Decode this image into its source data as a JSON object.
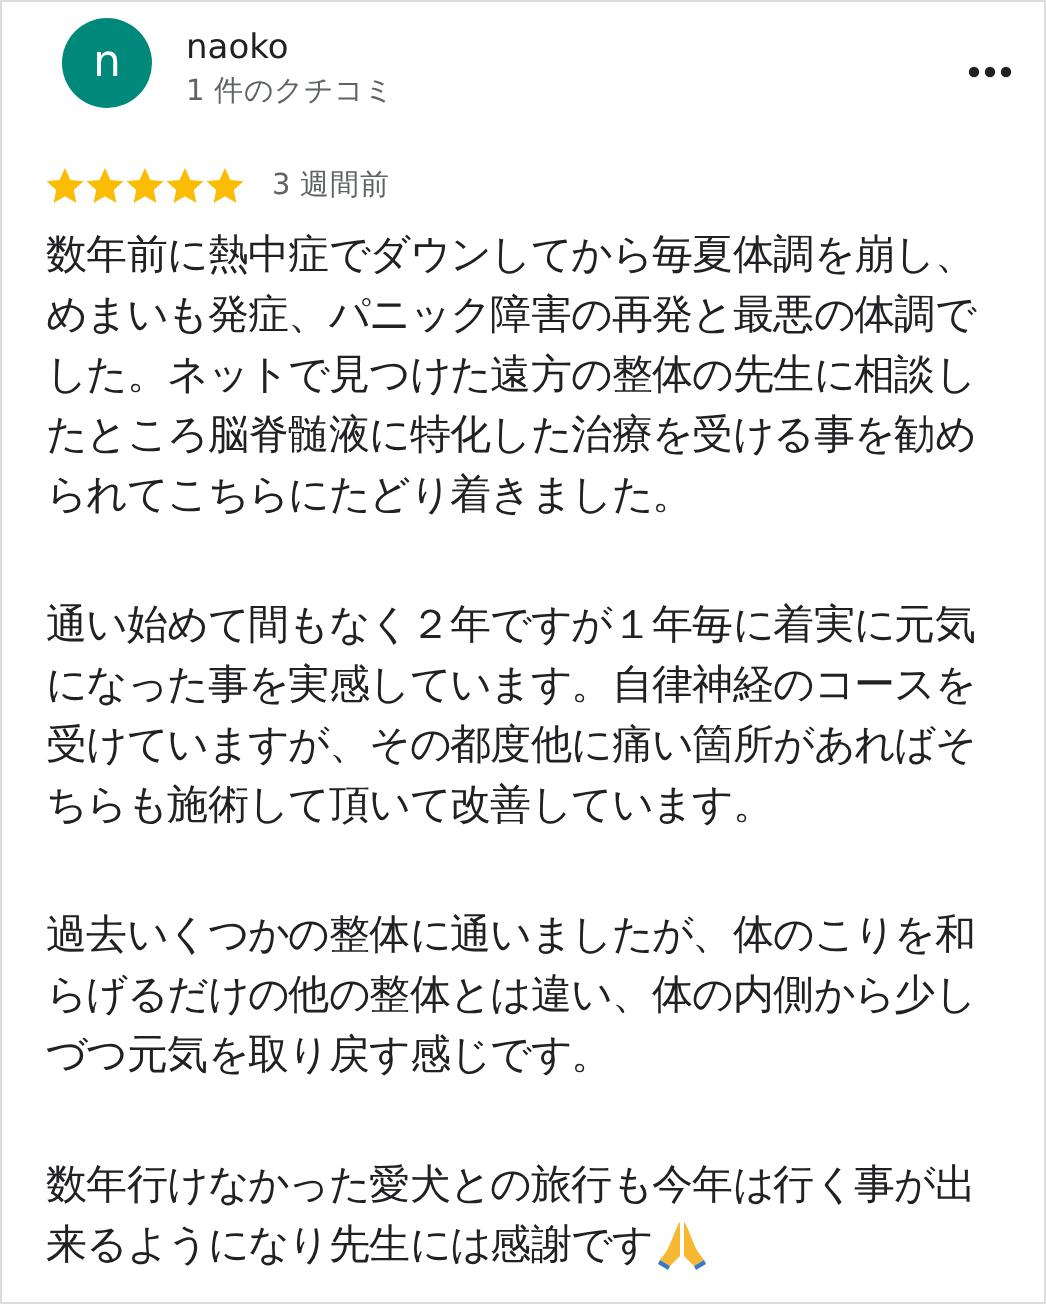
{
  "reviewer": {
    "avatar_letter": "n",
    "name": "naoko",
    "review_count": "1 件のクチコミ"
  },
  "rating": {
    "stars": 5,
    "time": "3 週間前"
  },
  "paragraphs": [
    "数年前に熱中症でダウンしてから毎夏体調を崩し、めまいも発症、パニック障害の再発と最悪の体調でした。ネットで見つけた遠方の整体の先生に相談したところ脳脊髄液に特化した治療を受ける事を勧められてこちらにたどり着きました。",
    "通い始めて間もなく２年ですが１年毎に着実に元気になった事を実感しています。自律神経のコースを受けていますが、その都度他に痛い箇所があればそちらも施術して頂いて改善しています。",
    "過去いくつかの整体に通いましたが、体のこりを和らげるだけの他の整体とは違い、体の内側から少しづつ元気を取り戻す感じです。",
    [
      "数年行けなかった愛犬との旅行も今年は行く事が出",
      "来るようになり先生には感謝です"
    ]
  ]
}
